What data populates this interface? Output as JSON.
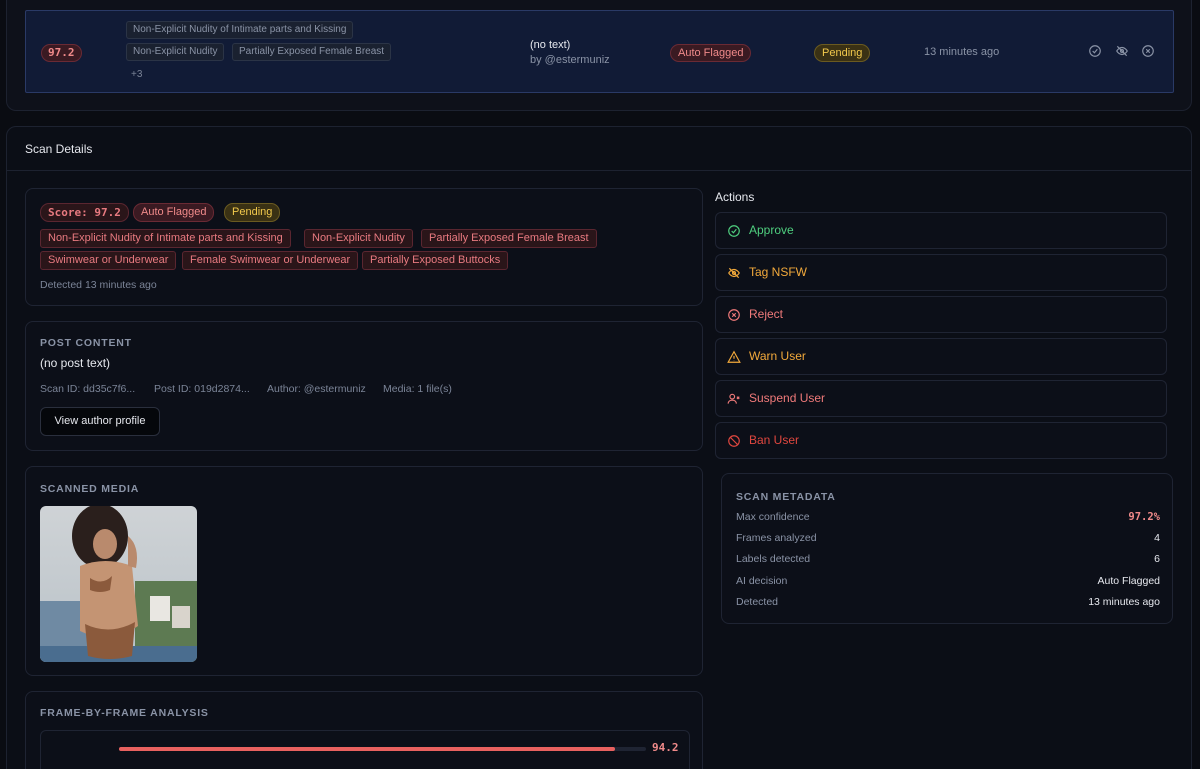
{
  "list_row": {
    "score": "97.2",
    "labels": [
      "Non-Explicit Nudity of Intimate parts and Kissing",
      "Non-Explicit Nudity",
      "Partially Exposed Female Breast"
    ],
    "more": "+3",
    "post_text": "(no text)",
    "author": "by @estermuniz",
    "status": "Auto Flagged",
    "review": "Pending",
    "time": "13 minutes ago",
    "icons": [
      "check-circle-icon",
      "eye-off-icon",
      "x-circle-icon"
    ]
  },
  "details": {
    "title": "Scan Details",
    "summary": {
      "score": "Score: 97.2",
      "status": "Auto Flagged",
      "review": "Pending",
      "labels": [
        "Non-Explicit Nudity of Intimate parts and Kissing",
        "Non-Explicit Nudity",
        "Partially Exposed Female Breast",
        "Swimwear or Underwear",
        "Female Swimwear or Underwear",
        "Partially Exposed Buttocks"
      ],
      "detected": "Detected 13 minutes ago"
    },
    "post": {
      "label": "POST CONTENT",
      "text": "(no post text)",
      "scan_id": "Scan ID: dd35c7f6...",
      "post_id": "Post ID: 019d2874...",
      "author": "Author: @estermuniz",
      "media": "Media: 1 file(s)",
      "profile_button": "View author profile"
    },
    "media": {
      "label": "SCANNED MEDIA"
    },
    "frames": {
      "label": "FRAME-BY-FRAME ANALYSIS",
      "first_score": "94.2",
      "first_fraction": 0.942
    }
  },
  "actions": {
    "title": "Actions",
    "items": [
      {
        "label": "Approve",
        "icon": "check-circle-icon",
        "color": "#4fcf7f"
      },
      {
        "label": "Tag NSFW",
        "icon": "eye-off-icon",
        "color": "#f2a93b"
      },
      {
        "label": "Reject",
        "icon": "x-circle-icon",
        "color": "#f07a7a"
      },
      {
        "label": "Warn User",
        "icon": "warning-icon",
        "color": "#f2a93b"
      },
      {
        "label": "Suspend User",
        "icon": "user-x-icon",
        "color": "#f07a7a"
      },
      {
        "label": "Ban User",
        "icon": "ban-icon",
        "color": "#e0473f"
      }
    ]
  },
  "metadata": {
    "label": "SCAN METADATA",
    "rows": [
      {
        "key": "Max confidence",
        "value": "97.2%"
      },
      {
        "key": "Frames analyzed",
        "value": "4"
      },
      {
        "key": "Labels detected",
        "value": "6"
      },
      {
        "key": "AI decision",
        "value": "Auto Flagged"
      },
      {
        "key": "Detected",
        "value": "13 minutes ago"
      }
    ]
  }
}
